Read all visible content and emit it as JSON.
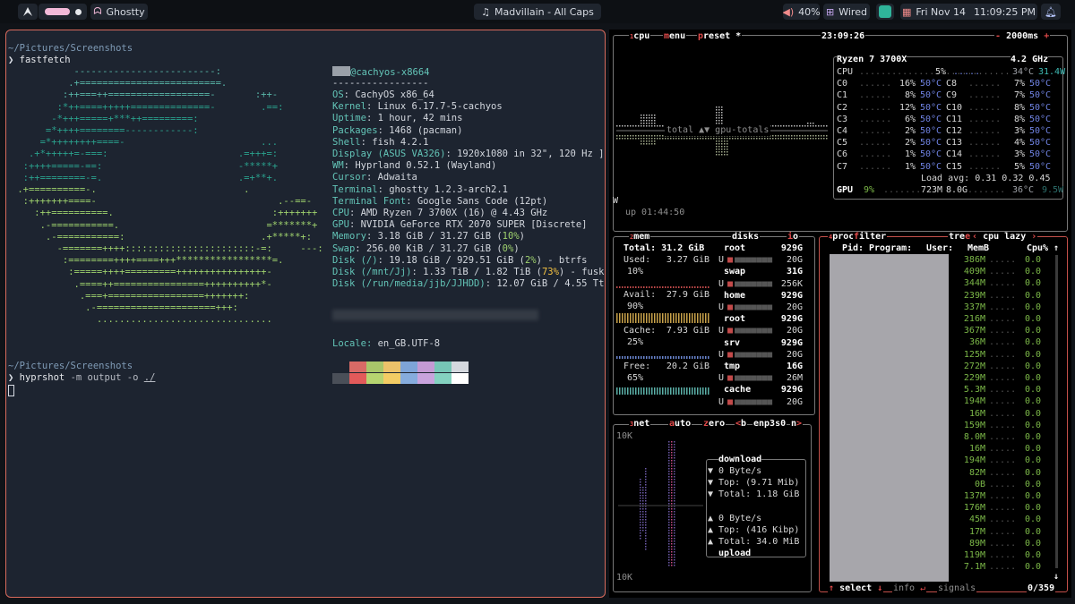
{
  "topbar": {
    "launcher_icon": "arch-logo-icon",
    "app_icon": "ghost-icon",
    "app_label": "Ghostty",
    "music_icon": "music-note-icon",
    "music_label": "Madvillain - All Caps",
    "volume_icon": "volume-icon",
    "volume_label": "40%",
    "network_icon": "network-icon",
    "network_label": "Wired",
    "calendar_icon": "calendar-icon",
    "date_label": "Fri Nov 14",
    "time_label": "11:09:25 PM",
    "bell_icon": "bell-icon",
    "colors": {
      "workspace_active": "#f3b9d8",
      "bar_bg": "#0d1014",
      "pill_bg": "#1f252e"
    }
  },
  "terminal": {
    "border_color": "#d86a5c",
    "block1": {
      "path": "~/Pictures/Screenshots",
      "prompt": "❯",
      "command": "fastfetch"
    },
    "logo_lines": [
      "           -------------------------:",
      "          .+=========================.",
      "         :++===++==================-       :++-",
      "        :*++====+++++==============-        .==:",
      "       -*+++=====+***++=========:",
      "      =*++++========------------:",
      "     =*++++++++====-                        ...",
      "   .+*+++++=-===:                       .=+++=:",
      "  :++++=====-==:                        -*****+",
      "  :++========-=.                        .=+**+.",
      " .+==========-.                          .",
      "  :+++++++====-                                .--==-",
      "    :++==========.                            :+++++++",
      "     .-===========.                          =*******+",
      "      .-===========:                        .+*****+:",
      "        -=======++++:::::::::::::::::::::::-=:     ---:",
      "         :========++++====+++*****************=.",
      "          :=====++++=========++++++++++++++++-",
      "           .====++================++++++++++*-",
      "            .===+=================+++++++:",
      "             .-=====================+++:",
      "               ..............................."
    ],
    "info": {
      "user_host": "@cachyos-x8664",
      "separator": "-----------------",
      "rows": [
        {
          "key": "OS",
          "value": "CachyOS x86_64"
        },
        {
          "key": "Kernel",
          "value": "Linux 6.17.7-5-cachyos"
        },
        {
          "key": "Uptime",
          "value": "1 hour, 42 mins"
        },
        {
          "key": "Packages",
          "value": "1468 (pacman)"
        },
        {
          "key": "Shell",
          "value": "fish 4.2.1"
        },
        {
          "key": "Display (ASUS VA326)",
          "value": "1920x1080 in 32\", 120 Hz ]"
        },
        {
          "key": "WM",
          "value": "Hyprland 0.52.1 (Wayland)"
        },
        {
          "key": "Cursor",
          "value": "Adwaita"
        },
        {
          "key": "Terminal",
          "value": "ghostty 1.2.3-arch2.1"
        },
        {
          "key": "Terminal Font",
          "value": "Google Sans Code (12pt)"
        },
        {
          "key": "CPU",
          "value": "AMD Ryzen 7 3700X (16) @ 4.43 GHz"
        },
        {
          "key": "GPU",
          "value": "NVIDIA GeForce RTX 2070 SUPER [Discrete]"
        },
        {
          "key": "Memory",
          "value": "3.18 GiB / 31.27 GiB (",
          "pct": "10%",
          "tail": ")"
        },
        {
          "key": "Swap",
          "value": "256.00 KiB / 31.27 GiB (",
          "pct": "0%",
          "tail": ")"
        },
        {
          "key": "Disk (/)",
          "value": "19.18 GiB / 929.51 GiB (",
          "pct": "2%",
          "tail": ") - btrfs"
        },
        {
          "key": "Disk (/mnt/Jj)",
          "value": "1.33 TiB / 1.82 TiB (",
          "pct": "73%",
          "tail": ") - fusk"
        },
        {
          "key": "Disk (/run/media/jjb/JJHDD)",
          "value": "12.07 GiB / 4.55 Tt",
          "pct": "",
          "tail": ""
        }
      ],
      "locale_key": "Locale",
      "locale_value": "en_GB.UTF-8",
      "palette_top": [
        "#1d2430",
        "#d86a66",
        "#a8c66a",
        "#ecc26a",
        "#7ea4d8",
        "#c49ad4",
        "#76c6b6",
        "#d4d8de"
      ],
      "palette_bottom": [
        "#4a4f58",
        "#e25a5a",
        "#b6d470",
        "#f3cc64",
        "#86acdd",
        "#c9a3dd",
        "#84d2c0",
        "#ffffff"
      ]
    },
    "block2": {
      "path": "~/Pictures/Screenshots",
      "prompt": "❯",
      "command": "hyprshot",
      "args": "-m output -o",
      "target": "./"
    }
  },
  "btop": {
    "cpu_box": {
      "title_num": "1",
      "title": "cpu",
      "menu": "menu",
      "preset": "preset *",
      "clock": "23:09:26",
      "minus": "-",
      "interval": "2000ms",
      "plus": "+",
      "graph_label": "total ▲▼ gpu-totals",
      "w_label": "W",
      "uptime": "up 01:44:50",
      "cpu_name": "Ryzen 7 3700X",
      "freq": "4.2 GHz",
      "total": {
        "label": "CPU",
        "pct": "5%",
        "temp": "34°C",
        "watt": "31.4W"
      },
      "cores_left": [
        {
          "name": "C0",
          "pct": "16%",
          "temp": "50°C"
        },
        {
          "name": "C1",
          "pct": "8%",
          "temp": "50°C"
        },
        {
          "name": "C2",
          "pct": "12%",
          "temp": "50°C"
        },
        {
          "name": "C3",
          "pct": "6%",
          "temp": "50°C"
        },
        {
          "name": "C4",
          "pct": "2%",
          "temp": "50°C"
        },
        {
          "name": "C5",
          "pct": "2%",
          "temp": "50°C"
        },
        {
          "name": "C6",
          "pct": "1%",
          "temp": "50°C"
        },
        {
          "name": "C7",
          "pct": "1%",
          "temp": "50°C"
        }
      ],
      "cores_right": [
        {
          "name": "C8",
          "pct": "7%",
          "temp": "50°C"
        },
        {
          "name": "C9",
          "pct": "7%",
          "temp": "50°C"
        },
        {
          "name": "C10",
          "pct": "8%",
          "temp": "50°C"
        },
        {
          "name": "C11",
          "pct": "8%",
          "temp": "50°C"
        },
        {
          "name": "C12",
          "pct": "3%",
          "temp": "50°C"
        },
        {
          "name": "C13",
          "pct": "4%",
          "temp": "50°C"
        },
        {
          "name": "C14",
          "pct": "3%",
          "temp": "50°C"
        },
        {
          "name": "C15",
          "pct": "5%",
          "temp": "50°C"
        }
      ],
      "load_avg": "Load avg: 0.31 0.32 0.45",
      "gpu": {
        "label": "GPU",
        "pct": "9%",
        "mem": "723M",
        "mem_total": "8.0G",
        "temp": "36°C",
        "watt": "9.5W"
      }
    },
    "mem_box": {
      "title_num": "2",
      "title": "mem",
      "total": "Total: 31.2 GiB",
      "used_label": "Used:",
      "used": "3.27 GiB",
      "used_pct": "10%",
      "avail_label": "Avail:",
      "avail": "27.9 GiB",
      "avail_pct": "90%",
      "cache_label": "Cache:",
      "cache": "7.93 GiB",
      "cache_pct": "25%",
      "free_label": "Free:",
      "free": "20.2 GiB",
      "free_pct": "65%"
    },
    "disks_box": {
      "title": "disks",
      "io": "io",
      "rows": [
        {
          "name": "root",
          "size": "929G",
          "u": "U",
          "used": "20G"
        },
        {
          "name": "swap",
          "size": "31G",
          "u": "U",
          "used": "256K"
        },
        {
          "name": "home",
          "size": "929G",
          "u": "U",
          "used": "20G"
        },
        {
          "name": "root",
          "size": "929G",
          "u": "U",
          "used": "20G"
        },
        {
          "name": "srv",
          "size": "929G",
          "u": "U",
          "used": "20G"
        },
        {
          "name": "tmp",
          "size": "16G",
          "u": "U",
          "used": "26M"
        },
        {
          "name": "cache",
          "size": "929G",
          "u": "U",
          "used": "20G"
        }
      ]
    },
    "net_box": {
      "title_num": "3",
      "title": "net",
      "auto": "auto",
      "zero": "zero",
      "b": "<b",
      "iface": "enp3s0",
      "n": "n>",
      "scale_top": "10K",
      "scale_bottom": "10K",
      "download_label": "download",
      "down_rate": "▼ 0 Byte/s",
      "down_top": "▼ Top: (9.71 Mib)",
      "down_total": "▼ Total: 1.18 GiB",
      "up_rate": "▲ 0 Byte/s",
      "up_top": "▲ Top: (416 Kibp)",
      "up_total": "▲ Total: 34.0 MiB",
      "upload_label": "upload"
    },
    "proc_box": {
      "title_num": "4",
      "title": "proc",
      "filter": "filter",
      "tree": "tree",
      "sort": "cpu lazy",
      "cols": {
        "pid": "Pid:",
        "program": "Program:",
        "user": "User:",
        "mem": "MemB",
        "cpu": "Cpu%"
      },
      "mem_values": [
        "386M",
        "409M",
        "344M",
        "239M",
        "337M",
        "216M",
        "367M",
        "36M",
        "125M",
        "272M",
        "229M",
        "5.3M",
        "194M",
        "16M",
        "159M",
        "8.0M",
        "16M",
        "194M",
        "82M",
        "0B",
        "137M",
        "176M",
        "45M",
        "17M",
        "89M",
        "119M",
        "7.1M"
      ],
      "cpu_values": [
        "0.0",
        "0.0",
        "0.0",
        "0.0",
        "0.0",
        "0.0",
        "0.0",
        "0.0",
        "0.0",
        "0.0",
        "0.0",
        "0.0",
        "0.0",
        "0.0",
        "0.0",
        "0.0",
        "0.0",
        "0.0",
        "0.0",
        "0.0",
        "0.0",
        "0.0",
        "0.0",
        "0.0",
        "0.0",
        "0.0",
        "0.0"
      ],
      "footer_select": "select",
      "footer_info": "info",
      "footer_signals": "signals",
      "count": "0/359"
    }
  }
}
